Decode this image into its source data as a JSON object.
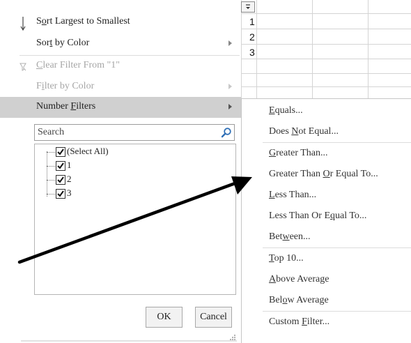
{
  "menu": {
    "sort_desc": {
      "pre": "S",
      "acc": "o",
      "post": "rt Largest to Smallest"
    },
    "sort_color": {
      "pre": "Sor",
      "acc": "t",
      "post": " by Color"
    },
    "clear_filter": {
      "pre": "",
      "acc": "C",
      "post": "lear Filter From \"1\""
    },
    "filter_color": {
      "pre": "F",
      "acc": "i",
      "post": "lter by Color"
    },
    "number_filters": {
      "pre": "Number ",
      "acc": "F",
      "post": "ilters"
    }
  },
  "search": {
    "placeholder": "Search"
  },
  "values": [
    {
      "label": "(Select All)",
      "checked": true
    },
    {
      "label": "1",
      "checked": true
    },
    {
      "label": "2",
      "checked": true
    },
    {
      "label": "3",
      "checked": true
    }
  ],
  "buttons": {
    "ok": "OK",
    "cancel": "Cancel"
  },
  "sheet": {
    "values": [
      "1",
      "2",
      "3"
    ]
  },
  "submenu": [
    {
      "pre": "",
      "acc": "E",
      "post": "quals..."
    },
    {
      "pre": "Does ",
      "acc": "N",
      "post": "ot Equal..."
    },
    {
      "pre": "",
      "acc": "G",
      "post": "reater Than..."
    },
    {
      "pre": "Greater Than ",
      "acc": "O",
      "post": "r Equal To..."
    },
    {
      "pre": "",
      "acc": "L",
      "post": "ess Than..."
    },
    {
      "pre": "Less Than Or E",
      "acc": "q",
      "post": "ual To..."
    },
    {
      "pre": "Bet",
      "acc": "w",
      "post": "een..."
    },
    {
      "pre": "",
      "acc": "T",
      "post": "op 10..."
    },
    {
      "pre": "",
      "acc": "A",
      "post": "bove Average"
    },
    {
      "pre": "Bel",
      "acc": "o",
      "post": "w Average"
    },
    {
      "pre": "Custom ",
      "acc": "F",
      "post": "ilter..."
    }
  ],
  "icons": {
    "sort_arrow": "sort-descending-arrow-icon",
    "clear_filter": "funnel-clear-icon",
    "search": "magnifier-icon",
    "submenu_arrow": "triangle-right-icon",
    "filter_dropdown": "filter-dropdown-icon"
  },
  "colors": {
    "active_item_bg": "#d0d0d0",
    "disabled_text": "#a6a6a6",
    "search_icon": "#2f6fb6",
    "arrow": "#000000"
  }
}
